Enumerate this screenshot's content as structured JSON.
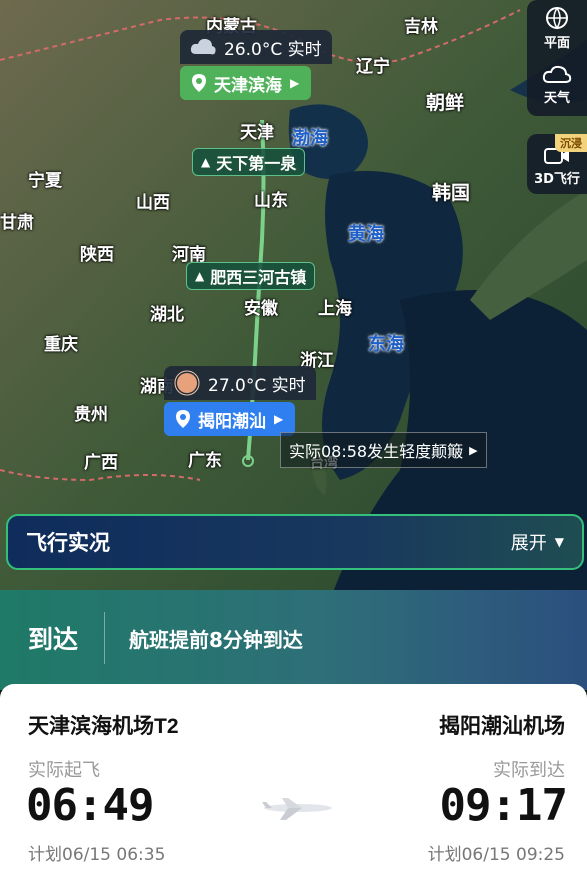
{
  "map": {
    "labels": {
      "inner_mongolia": "内蒙古",
      "jilin": "吉林",
      "liaoning": "辽宁",
      "north_korea": "朝鲜",
      "tianjin": "天津",
      "bohai": "渤海",
      "ningxia": "宁夏",
      "gansu": "甘肃",
      "shanxi": "山西",
      "shandong": "山东",
      "south_korea": "韩国",
      "yellow_sea": "黄海",
      "shaanxi": "陕西",
      "henan": "河南",
      "hubei": "湖北",
      "anhui": "安徽",
      "shanghai": "上海",
      "east_sea": "东海",
      "chongqing": "重庆",
      "zhejiang": "浙江",
      "hunan": "湖南",
      "guizhou": "贵州",
      "guangxi": "广西",
      "guangdong": "广东",
      "taiwan": "台湾"
    },
    "origin_weather": {
      "temp": "26.0°C 实时"
    },
    "origin_pin": {
      "label": "天津滨海"
    },
    "poi_1": "天下第一泉",
    "poi_2": "肥西三河古镇",
    "dest_weather": {
      "temp": "27.0°C 实时"
    },
    "dest_pin": {
      "label": "揭阳潮汕"
    },
    "turbulence": "实际08:58发生轻度颠簸",
    "side": {
      "flat": "平面",
      "weather": "天气",
      "immersive_badge": "沉浸",
      "fly3d": "3D飞行"
    }
  },
  "flight_status": {
    "title": "飞行实况",
    "expand": "展开"
  },
  "arrival_banner": {
    "state": "到达",
    "message": "航班提前8分钟到达"
  },
  "card": {
    "origin_airport": "天津滨海机场T2",
    "dest_airport": "揭阳潮汕机场",
    "dep_label": "实际起飞",
    "arr_label": "实际到达",
    "dep_time": "06:49",
    "arr_time": "09:17",
    "dep_plan": "计划06/15 06:35",
    "arr_plan": "计划06/15 09:25"
  },
  "colors": {
    "route": "#7bd08a",
    "pin_green": "#4fb25a",
    "pin_blue": "#2f7ff0",
    "status_border": "#34c07a"
  }
}
